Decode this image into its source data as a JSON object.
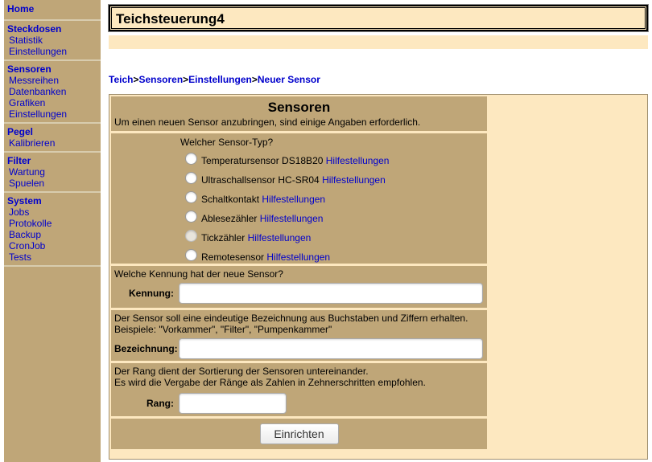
{
  "site_title": "Teichsteuerung4",
  "nav": {
    "home": "Home",
    "sections": [
      {
        "title": "Steckdosen",
        "items": [
          "Statistik",
          "Einstellungen"
        ]
      },
      {
        "title": "Sensoren",
        "items": [
          "Messreihen",
          "Datenbanken",
          "Grafiken",
          "Einstellungen"
        ]
      },
      {
        "title": "Pegel",
        "items": [
          "Kalibrieren"
        ]
      },
      {
        "title": "Filter",
        "items": [
          "Wartung",
          "Spuelen"
        ]
      },
      {
        "title": "System",
        "items": [
          "Jobs",
          "Protokolle",
          "Backup",
          "CronJob",
          "Tests"
        ]
      }
    ]
  },
  "breadcrumb": [
    "Teich",
    "Sensoren",
    "Einstellungen",
    "Neuer Sensor"
  ],
  "breadcrumb_sep": ">",
  "form": {
    "heading": "Sensoren",
    "intro": "Um einen neuen Sensor anzubringen, sind einige Angaben erforderlich.",
    "type_question": "Welcher Sensor-Typ?",
    "help_link": "Hilfestellungen",
    "sensor_types": [
      {
        "label": "Temperatursensor DS18B20",
        "disabled": false
      },
      {
        "label": "Ultraschallsensor HC-SR04",
        "disabled": false
      },
      {
        "label": "Schaltkontakt",
        "disabled": false
      },
      {
        "label": "Ablesezähler",
        "disabled": false
      },
      {
        "label": "Tickzähler",
        "disabled": true
      },
      {
        "label": "Remotesensor",
        "disabled": false
      }
    ],
    "kennung_question": "Welche Kennung hat der neue Sensor?",
    "kennung_label": "Kennung:",
    "kennung_value": "",
    "bez_info_1": "Der Sensor soll eine eindeutige Bezeichnung aus Buchstaben und Ziffern erhalten.",
    "bez_info_2": "Beispiele: \"Vorkammer\", \"Filter\", \"Pumpenkammer\"",
    "bez_label": "Bezeichnung:",
    "bez_value": "",
    "rang_info_1": "Der Rang dient der Sortierung der Sensoren untereinander.",
    "rang_info_2": "Es wird die Vergabe der Ränge als Zahlen in Zehnerschritten empfohlen.",
    "rang_label": "Rang:",
    "rang_value": "",
    "submit_label": "Einrichten"
  },
  "colors": {
    "sidebar": "#bfa678",
    "header_bg": "#fde8c0",
    "link": "#0000cc"
  }
}
